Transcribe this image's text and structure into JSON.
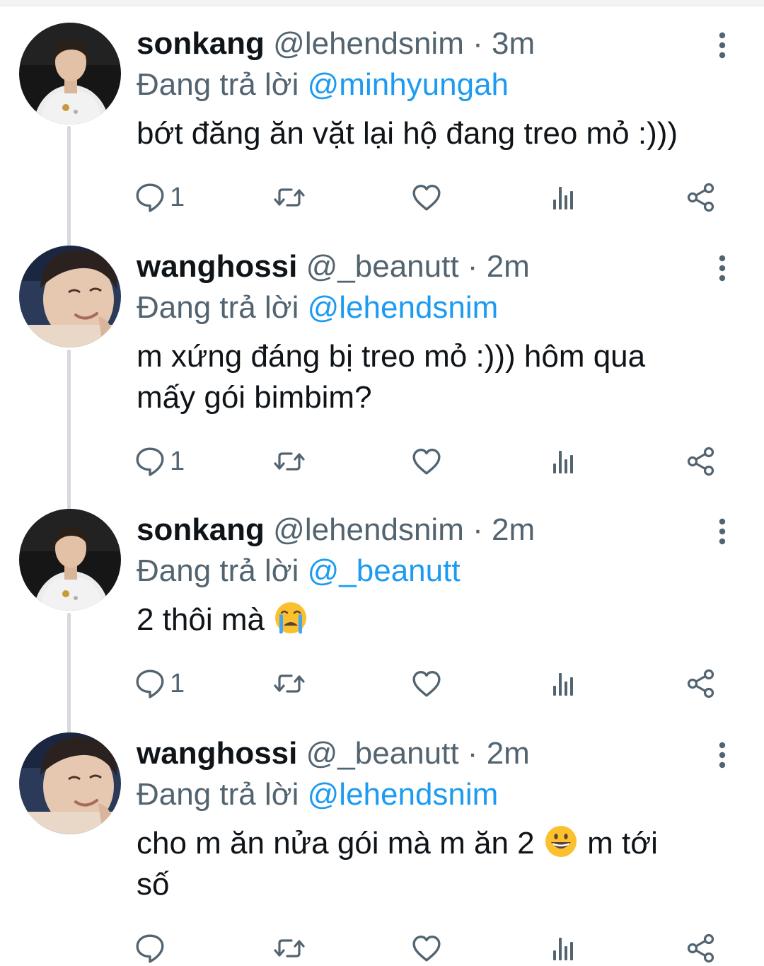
{
  "tweets": [
    {
      "name": "sonkang",
      "handle": "@lehendsnim",
      "dot": "·",
      "time": "3m",
      "reply_prefix": "Đang trả lời",
      "reply_to": "@minhyungah",
      "text_lines": [
        "bớt đăng ăn vặt lại hộ đang treo mỏ :)))"
      ],
      "reply_count": "1",
      "avatar_icon": "person-white-shirt-avatar"
    },
    {
      "name": "wanghossi",
      "handle": "@_beanutt",
      "dot": "·",
      "time": "2m",
      "reply_prefix": "Đang trả lời",
      "reply_to": "@lehendsnim",
      "text_lines": [
        "m xứng đáng bị treo mỏ :))) hôm qua",
        "mấy gói bimbim?"
      ],
      "reply_count": "1",
      "avatar_icon": "smiling-face-avatar"
    },
    {
      "name": "sonkang",
      "handle": "@lehendsnim",
      "dot": "·",
      "time": "2m",
      "reply_prefix": "Đang trả lời",
      "reply_to": "@_beanutt",
      "text_lines": [
        "2 thôi mà"
      ],
      "emoji": "loudly-crying-face-emoji",
      "reply_count": "1",
      "avatar_icon": "person-white-shirt-avatar"
    },
    {
      "name": "wanghossi",
      "handle": "@_beanutt",
      "dot": "·",
      "time": "2m",
      "reply_prefix": "Đang trả lời",
      "reply_to": "@lehendsnim",
      "text_lines": [
        "cho m ăn nửa gói mà m ăn 2",
        "m tới",
        "số"
      ],
      "emoji": "grinning-face-emoji",
      "reply_count": "",
      "avatar_icon": "smiling-face-avatar"
    }
  ],
  "icons": {
    "reply": "reply-bubble-icon",
    "retweet": "retweet-icon",
    "like": "heart-icon",
    "analytics": "analytics-bars-icon",
    "share": "share-icon",
    "menu": "more-vertical-icon"
  },
  "colors": {
    "mention": "#1d9bf0",
    "secondary_text": "#536471",
    "primary_text": "#0f1419",
    "thread_line": "#d6dade"
  }
}
